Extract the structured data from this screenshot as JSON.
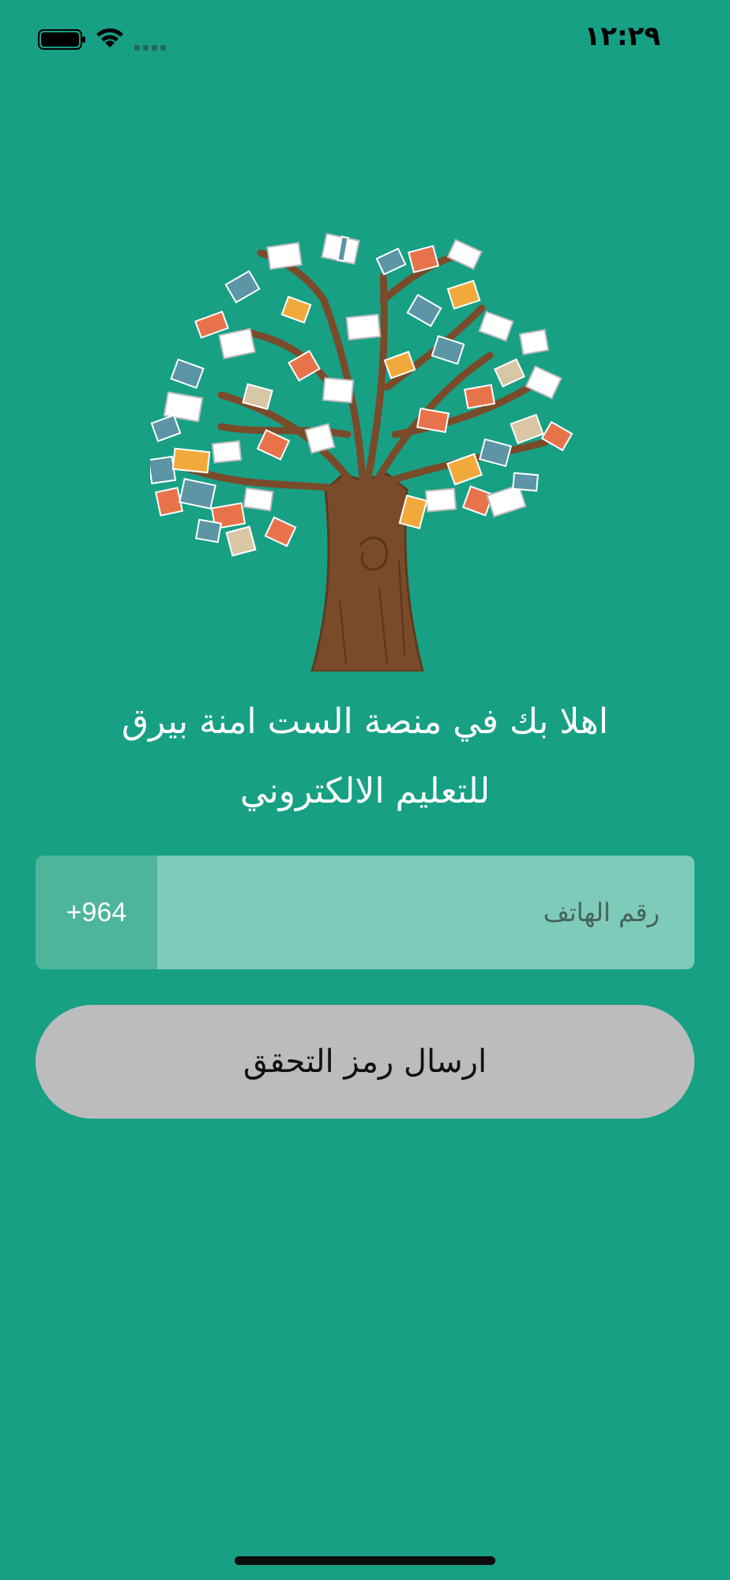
{
  "status_bar": {
    "time": "١٢:٢٩",
    "battery_icon": "battery-full-icon",
    "wifi_icon": "wifi-icon",
    "signal_icon": "cellular-signal-icon"
  },
  "hero": {
    "icon": "book-tree-illustration"
  },
  "welcome": {
    "line1": "اهلا بك في منصة الست امنة بيرق",
    "line2": "للتعليم الالكتروني"
  },
  "phone": {
    "country_code": "+964",
    "placeholder": "رقم الهاتف",
    "value": ""
  },
  "actions": {
    "send_code_label": "ارسال رمز التحقق"
  },
  "colors": {
    "background": "#17a084",
    "input_bg": "#7fcbb9",
    "code_bg": "#4db59b",
    "button_bg": "#bcbcbc"
  }
}
